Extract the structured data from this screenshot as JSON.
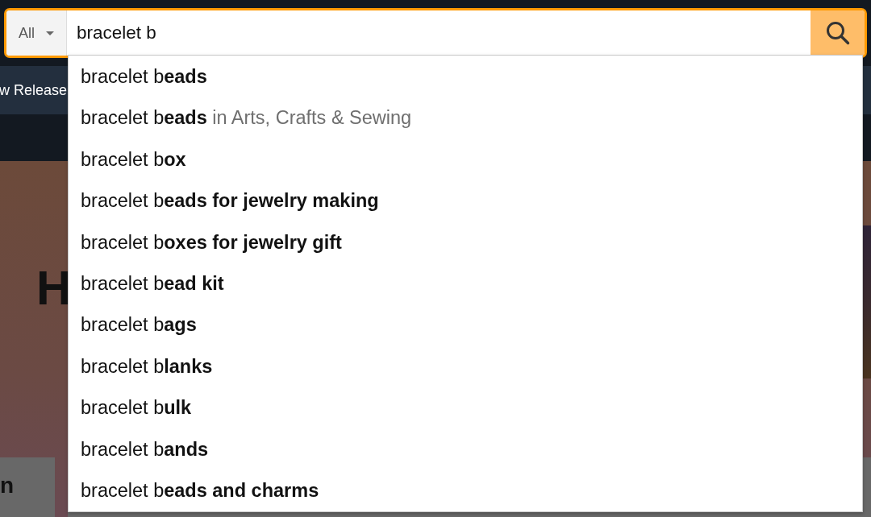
{
  "search": {
    "category": "All",
    "query": "bracelet b"
  },
  "nav": {
    "items": [
      {
        "label": "w Release"
      }
    ]
  },
  "hero": {
    "heading": "H"
  },
  "cards": [
    {
      "text": "n"
    }
  ],
  "suggestions": [
    {
      "text": "bracelet b**eads**"
    },
    {
      "text": "bracelet b**eads**",
      "department": "in Arts, Crafts & Sewing"
    },
    {
      "text": "bracelet b**ox**"
    },
    {
      "text": "bracelet b**eads for jewelry making**"
    },
    {
      "text": "bracelet b**oxes for jewelry gift**"
    },
    {
      "text": "bracelet b**ead kit**"
    },
    {
      "text": "bracelet b**ags**"
    },
    {
      "text": "bracelet b**lanks**"
    },
    {
      "text": "bracelet b**ulk**"
    },
    {
      "text": "bracelet b**ands**"
    },
    {
      "text": "bracelet b**eads and charms**"
    }
  ]
}
